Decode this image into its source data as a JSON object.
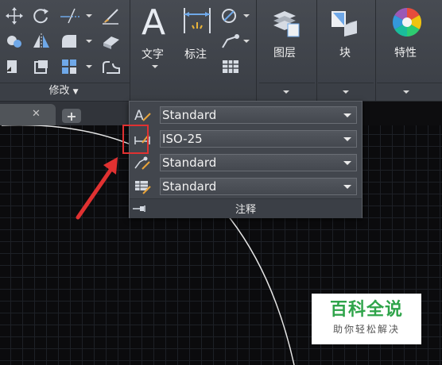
{
  "ribbon": {
    "modify_panel": {
      "label": "修改",
      "tools": [
        "move-icon",
        "rotate-icon",
        "trim-icon",
        "paint-brush-icon",
        "copy-icon",
        "mirror-icon",
        "fillet-icon",
        "erase-icon",
        "stretch-icon",
        "scale-icon",
        "array-icon",
        "offset-icon"
      ]
    },
    "text_button": {
      "label": "文字",
      "glyph": "A"
    },
    "dimension_button": {
      "label": "标注"
    },
    "layers_button": {
      "label": "图层"
    },
    "block_button": {
      "label": "块"
    },
    "properties_button": {
      "label": "特性"
    }
  },
  "annotation_panel": {
    "title": "注释",
    "rows": [
      {
        "icon": "text-style-icon",
        "value": "Standard"
      },
      {
        "icon": "dimension-style-icon",
        "value": "ISO-25"
      },
      {
        "icon": "multileader-style-icon",
        "value": "Standard"
      },
      {
        "icon": "table-style-icon",
        "value": "Standard"
      }
    ]
  },
  "tabs": {
    "close_glyph": "✕",
    "add_glyph": "+"
  },
  "watermark": {
    "title": "百科全说",
    "subtitle": "助你轻松解决"
  },
  "colors": {
    "ribbon_bg": "#474b52",
    "canvas_bg": "#0b0b0d",
    "highlight": "#e03131",
    "watermark_green": "#2fa44a"
  }
}
